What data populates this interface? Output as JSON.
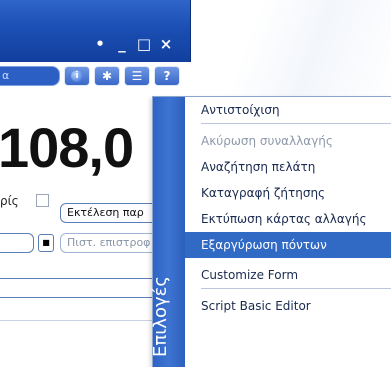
{
  "window": {
    "title_controls": {
      "pin": "•",
      "minimize": "_",
      "maximize": "□",
      "close": "×"
    },
    "search_value": "α"
  },
  "toolbar": {
    "buttons": [
      {
        "name": "info-button",
        "glyph": "i"
      },
      {
        "name": "settings-button",
        "glyph": "✱"
      },
      {
        "name": "menu-button",
        "glyph": "☰"
      },
      {
        "name": "help-button",
        "glyph": "?"
      }
    ]
  },
  "main": {
    "amount": "108,0",
    "row_label_partial": "ρίς",
    "execute_button_label": "Εκτέλεση παρ",
    "mini_button_label": "■",
    "credit_field_placeholder": "Πιστ. επιστροφ"
  },
  "menu": {
    "sidebar_label": "Επιλογές",
    "items": [
      {
        "label": "Αντιστοίχιση",
        "state": "normal"
      },
      {
        "label": "Ακύρωση συναλλαγής",
        "state": "disabled"
      },
      {
        "label": "Αναζήτηση πελάτη",
        "state": "normal"
      },
      {
        "label": "Καταγραφή ζήτησης",
        "state": "normal"
      },
      {
        "label": "Εκτύπωση κάρτας αλλαγής",
        "state": "normal"
      },
      {
        "label": "Εξαργύρωση πόντων",
        "state": "active"
      },
      {
        "label": "Customize Form",
        "state": "normal"
      },
      {
        "label": "Script Basic Editor",
        "state": "normal"
      }
    ]
  },
  "colors": {
    "titlebar": "#1b4fb4",
    "menu_sidebar": "#3e74d1",
    "menu_highlight": "#316ac5"
  }
}
